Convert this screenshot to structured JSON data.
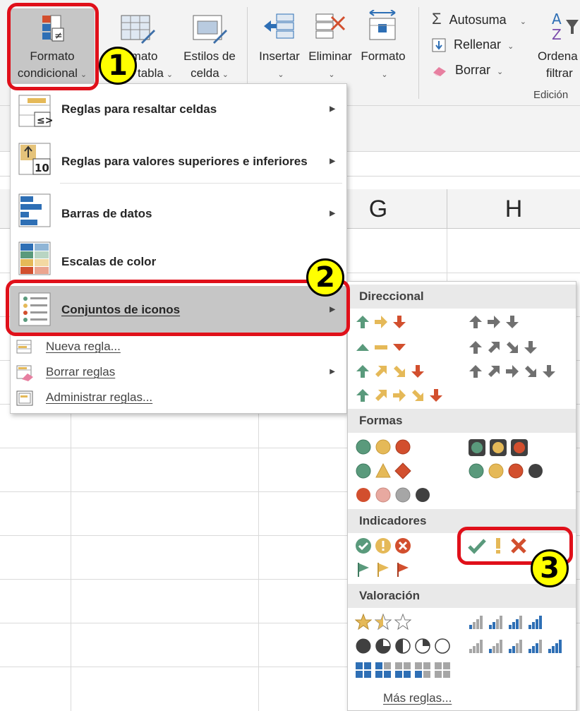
{
  "ribbon": {
    "formato_condicional": [
      "Formato",
      "condicional"
    ],
    "formato_tabla": [
      "rmato",
      "tabla"
    ],
    "estilos_celda": [
      "Estilos de",
      "celda"
    ],
    "insertar": "Insertar",
    "eliminar": "Eliminar",
    "formato": "Formato",
    "autosuma": "Autosuma",
    "rellenar": "Rellenar",
    "borrar": "Borrar",
    "ordenar": [
      "Ordena",
      "filtrar"
    ],
    "edicion_group": "Edición"
  },
  "columns": [
    "G",
    "H"
  ],
  "menu": {
    "items": [
      {
        "label": "Reglas para resaltar celdas",
        "icon": "highlight-rules-icon"
      },
      {
        "label": "Reglas para valores superiores e inferiores",
        "icon": "top-bottom-rules-icon"
      },
      {
        "label": "Barras de datos",
        "icon": "data-bars-icon"
      },
      {
        "label": "Escalas de color",
        "icon": "color-scales-icon"
      },
      {
        "label": "Conjuntos de iconos",
        "icon": "icon-sets-icon"
      }
    ],
    "small_items": [
      {
        "label": "Nueva regla...",
        "icon": "new-rule-icon"
      },
      {
        "label": "Borrar reglas",
        "icon": "clear-rules-icon"
      },
      {
        "label": "Administrar reglas...",
        "icon": "manage-rules-icon"
      }
    ]
  },
  "submenu": {
    "sections": {
      "direccional": "Direccional",
      "formas": "Formas",
      "indicadores": "Indicadores",
      "valoracion": "Valoración"
    },
    "more_rules": "Más reglas..."
  },
  "callouts": [
    "1",
    "2",
    "3"
  ],
  "colors": {
    "green": "#5a9a7c",
    "yellow": "#e5b958",
    "red": "#d24f2e",
    "gray": "#707070",
    "black": "#404040",
    "pink": "#e8a9a0",
    "lightgray": "#a6a6a6",
    "blue": "#2e6fb5",
    "callout_red": "#e0101a",
    "badge_yellow": "#ffff00"
  }
}
